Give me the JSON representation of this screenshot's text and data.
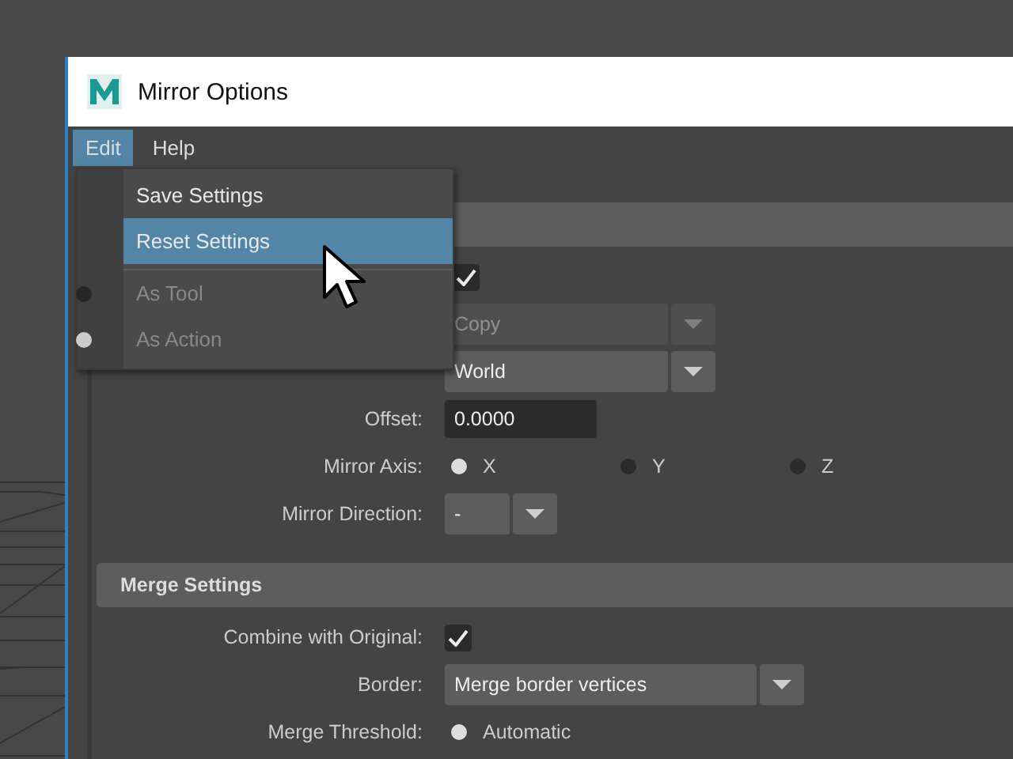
{
  "window": {
    "title": "Mirror Options"
  },
  "menubar": [
    {
      "label": "Edit",
      "selected": true
    },
    {
      "label": "Help",
      "selected": false
    }
  ],
  "edit_menu": {
    "items": [
      {
        "kind": "command",
        "label": "Save Settings",
        "selected": false,
        "disabled": false
      },
      {
        "kind": "command",
        "label": "Reset Settings",
        "selected": true,
        "disabled": false
      },
      {
        "kind": "separator"
      },
      {
        "kind": "radio",
        "label": "As Tool",
        "checked": false,
        "disabled": true
      },
      {
        "kind": "radio",
        "label": "As Action",
        "checked": true,
        "disabled": true
      }
    ]
  },
  "mirror_settings": {
    "rows": [
      {
        "kind": "checkbox",
        "checked": true,
        "disabled": false
      },
      {
        "kind": "dropdown",
        "value": "Copy",
        "disabled": true
      },
      {
        "kind": "dropdown",
        "value": "World",
        "disabled": false
      },
      {
        "kind": "number",
        "label": "Offset:",
        "value": "0.0000",
        "disabled": false
      },
      {
        "kind": "radio",
        "label": "Mirror Axis:",
        "disabled": false,
        "options": [
          {
            "label": "X",
            "selected": true
          },
          {
            "label": "Y",
            "selected": false
          },
          {
            "label": "Z",
            "selected": false
          }
        ]
      },
      {
        "kind": "dropdown",
        "label": "Mirror Direction:",
        "value": "-",
        "disabled": false
      }
    ]
  },
  "merge_settings": {
    "title": "Merge Settings",
    "rows": [
      {
        "kind": "checkbox",
        "label": "Combine with Original:",
        "checked": true,
        "disabled": false
      },
      {
        "kind": "dropdown",
        "label": "Border:",
        "value": "Merge border vertices",
        "disabled": false
      },
      {
        "kind": "radio",
        "label": "Merge Threshold:",
        "disabled": false,
        "options": [
          {
            "label": "Automatic",
            "selected": true
          }
        ]
      }
    ]
  }
}
